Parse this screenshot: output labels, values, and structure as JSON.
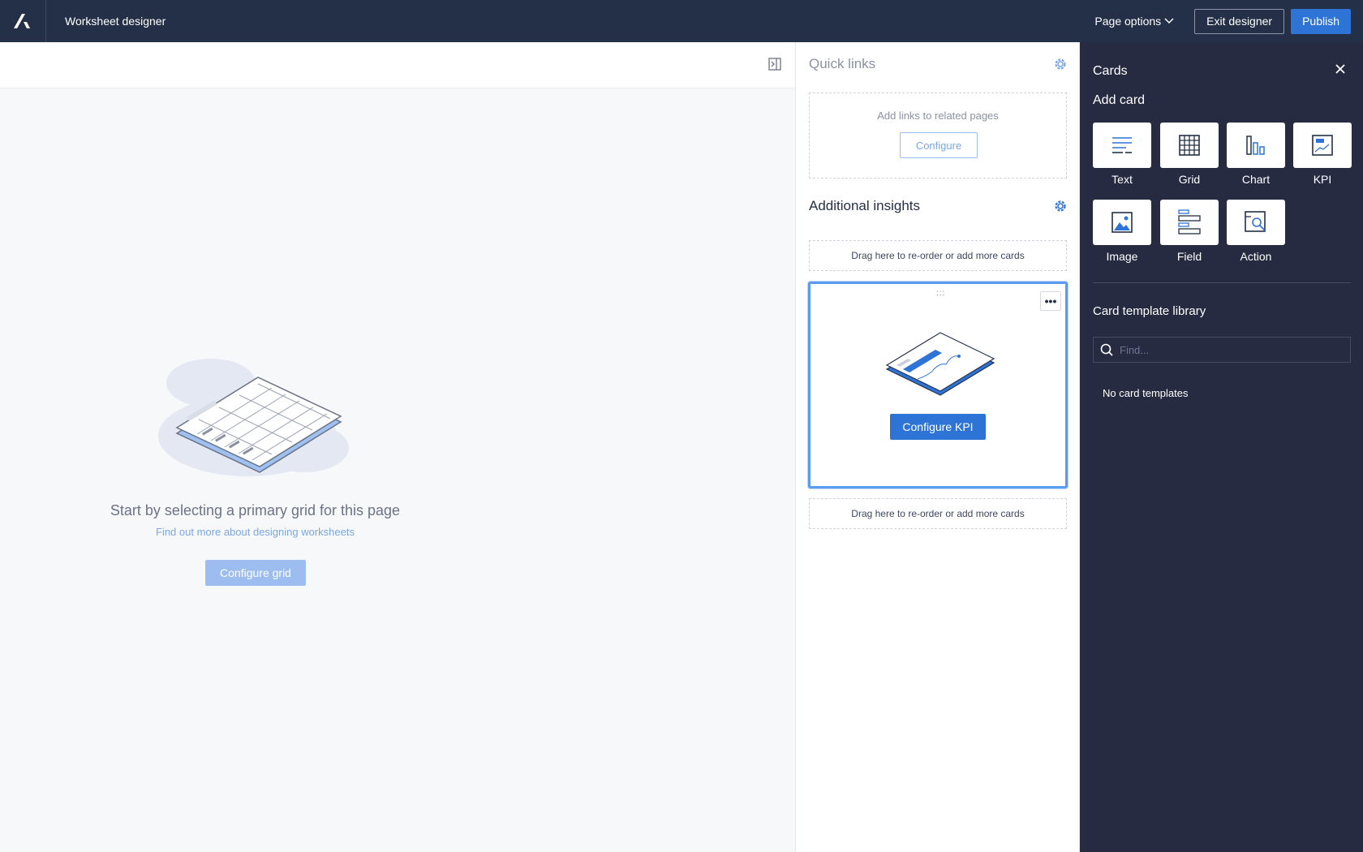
{
  "header": {
    "title": "Worksheet designer",
    "page_options": "Page options",
    "exit": "Exit designer",
    "publish": "Publish"
  },
  "canvas": {
    "empty_title": "Start by selecting a primary grid for this page",
    "empty_link": "Find out more about designing worksheets",
    "configure_grid": "Configure grid"
  },
  "quick_links": {
    "title": "Quick links",
    "hint": "Add links to related pages",
    "configure": "Configure"
  },
  "insights": {
    "title": "Additional insights",
    "drop_top": "Drag here to re-order or add more cards",
    "drop_bottom": "Drag here to re-order or add more cards",
    "drag_handle": ":::",
    "more": "•••",
    "configure_kpi": "Configure KPI"
  },
  "cards_panel": {
    "title": "Cards",
    "add_card": "Add card",
    "tiles": [
      {
        "label": "Text",
        "icon": "text-lines-icon"
      },
      {
        "label": "Grid",
        "icon": "grid-icon"
      },
      {
        "label": "Chart",
        "icon": "bar-chart-icon"
      },
      {
        "label": "KPI",
        "icon": "kpi-icon"
      },
      {
        "label": "Image",
        "icon": "image-icon"
      },
      {
        "label": "Field",
        "icon": "field-icon"
      },
      {
        "label": "Action",
        "icon": "action-icon"
      }
    ],
    "library_title": "Card template library",
    "search_placeholder": "Find...",
    "empty": "No card templates"
  },
  "colors": {
    "topbar": "#243048",
    "primary": "#2e74d6",
    "panel_dark": "#262b42"
  }
}
